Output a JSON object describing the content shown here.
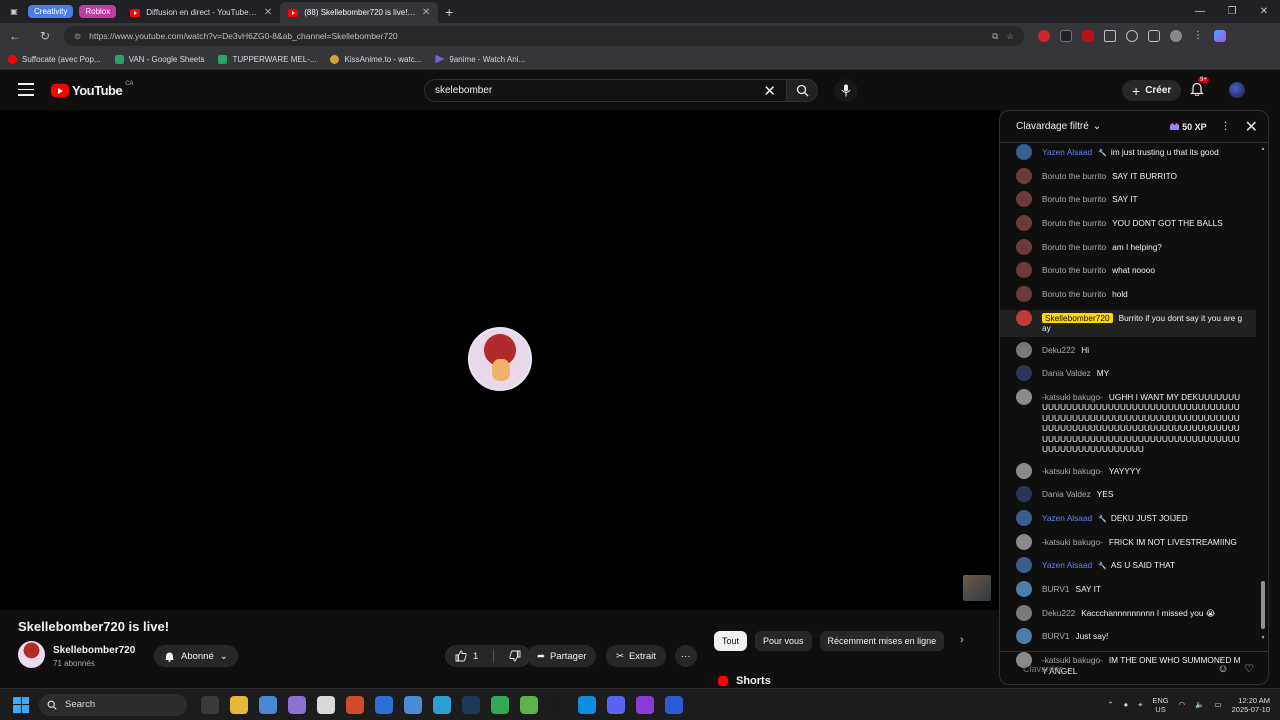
{
  "browser": {
    "tab_groups": [
      {
        "label": "Creativity",
        "color": "#4a7de8"
      },
      {
        "label": "Roblox",
        "color": "#c43aa4"
      }
    ],
    "tabs": [
      {
        "title": "Diffusion en direct - YouTube Stu",
        "active": false
      },
      {
        "title": "(88) Skellebomber720 is live! - Yo",
        "active": true
      }
    ],
    "url": "https://www.youtube.com/watch?v=De3vH6ZG0-8&ab_channel=Skellebomber720",
    "bookmarks": [
      {
        "label": "Suffocate (avec Pop...",
        "color": "#ff0000"
      },
      {
        "label": "VAN - Google Sheets",
        "color": "#22a565"
      },
      {
        "label": "TUPPERWARE MEL-...",
        "color": "#22a565"
      },
      {
        "label": "KissAnime.to - watc...",
        "color": "#d9a13a"
      },
      {
        "label": "9anime - Watch Ani...",
        "color": "#7b5cd6"
      }
    ]
  },
  "youtube": {
    "logo_text": "YouTube",
    "country_code": "CA",
    "search_value": "skelebomber",
    "create_label": "Créer",
    "notif_badge": "9+"
  },
  "video": {
    "title": "Skellebomber720 is live!",
    "channel": "Skellebomber720",
    "subscribers": "71 abonnés",
    "subscribed_label": "Abonné",
    "likes": "1",
    "share_label": "Partager",
    "clip_label": "Extrait",
    "more_label": "···"
  },
  "related": {
    "chips": [
      {
        "label": "Tout",
        "selected": true
      },
      {
        "label": "Pour vous",
        "selected": false
      },
      {
        "label": "Récemment mises en ligne",
        "selected": false
      }
    ],
    "shorts_label": "Shorts"
  },
  "chat": {
    "mode": "Clavardage filtré",
    "xp": "50 XP",
    "input_placeholder": "Clavarder...",
    "messages": [
      {
        "author": "Yazen Alsaad",
        "role": "mod",
        "text": "im just trusting u that its good",
        "avatar": "#3b5e8c"
      },
      {
        "author": "Boruto the burrito",
        "role": "",
        "text": "SAY IT BURRITO",
        "avatar": "#6b3a3a"
      },
      {
        "author": "Boruto the burrito",
        "role": "",
        "text": "SAY IT",
        "avatar": "#6b3a3a"
      },
      {
        "author": "Boruto the burrito",
        "role": "",
        "text": "YOU DONT GOT THE BALLS",
        "avatar": "#6b3a3a"
      },
      {
        "author": "Boruto the burrito",
        "role": "",
        "text": "am I helping?",
        "avatar": "#6b3a3a"
      },
      {
        "author": "Boruto the burrito",
        "role": "",
        "text": "what noooo",
        "avatar": "#6b3a3a"
      },
      {
        "author": "Boruto the burrito",
        "role": "",
        "text": "hold",
        "avatar": "#6b3a3a"
      },
      {
        "author": "Skellebomber720",
        "role": "owner",
        "text": "Burrito if you dont say it you are gay",
        "avatar": "#c0393b"
      },
      {
        "author": "Deku222",
        "role": "",
        "text": "Hi",
        "avatar": "#7a7a7a"
      },
      {
        "author": "Dania Valdez",
        "role": "",
        "text": "MY",
        "avatar": "#2c3555"
      },
      {
        "author": "-katsuki bakugo-",
        "role": "",
        "text": "UGHH I WANT MY DEKUUUUUUUUUUUUUUUUUUUUUUUUUUUUUUUUUUUUUUUUUUUUUUUUUUUUUUUUUUUUUUUUUUUUUUUUUUUUUUUUUUUUUUUUUUUUUUUUUUUUUUUUUUUUUUUUUUUUUUUUUUUUUUUUUUUUUUUUUUUUUUUUUUUUUUUUUUUU",
        "avatar": "#8a8a8a"
      },
      {
        "author": "-katsuki bakugo-",
        "role": "",
        "text": "YAYYYY",
        "avatar": "#8a8a8a"
      },
      {
        "author": "Dania Valdez",
        "role": "",
        "text": "YES",
        "avatar": "#2c3555"
      },
      {
        "author": "Yazen Alsaad",
        "role": "mod",
        "text": "DEKU JUST JOIJED",
        "avatar": "#3b5e8c"
      },
      {
        "author": "-katsuki bakugo-",
        "role": "",
        "text": "FRICK IM NOT LIVESTREAMIING",
        "avatar": "#8a8a8a"
      },
      {
        "author": "Yazen Alsaad",
        "role": "mod",
        "text": "AS U SAID THAT",
        "avatar": "#3b5e8c"
      },
      {
        "author": "BURV1",
        "role": "",
        "text": "SAY IT",
        "avatar": "#4e7ea8"
      },
      {
        "author": "Deku222",
        "role": "",
        "text": "Kaccchannnnnnnnn I missed you 😭",
        "avatar": "#7a7a7a"
      },
      {
        "author": "BURV1",
        "role": "",
        "text": "Just say!",
        "avatar": "#4e7ea8"
      },
      {
        "author": "-katsuki bakugo-",
        "role": "",
        "text": "IM THE ONE WHO SUMMONED MY ANGEL",
        "avatar": "#8a8a8a"
      }
    ]
  },
  "taskbar": {
    "search_label": "Search",
    "lang_top": "ENG",
    "lang_bottom": "US",
    "time": "12:20 AM",
    "date": "2025-07-10",
    "apps": [
      "#3a3a3a",
      "#e8b73a",
      "#4b88d6",
      "#8e6fd3",
      "#d9d9d9",
      "#cf4b2a",
      "#2b6fd6",
      "#4b8ad6",
      "#2a9fd6",
      "#1b3a5a",
      "#34a853",
      "#5bb34a",
      "#1b1b1b",
      "#0e8ddf",
      "#5865f2",
      "#8a3ad6",
      "#2d5bd6"
    ]
  }
}
